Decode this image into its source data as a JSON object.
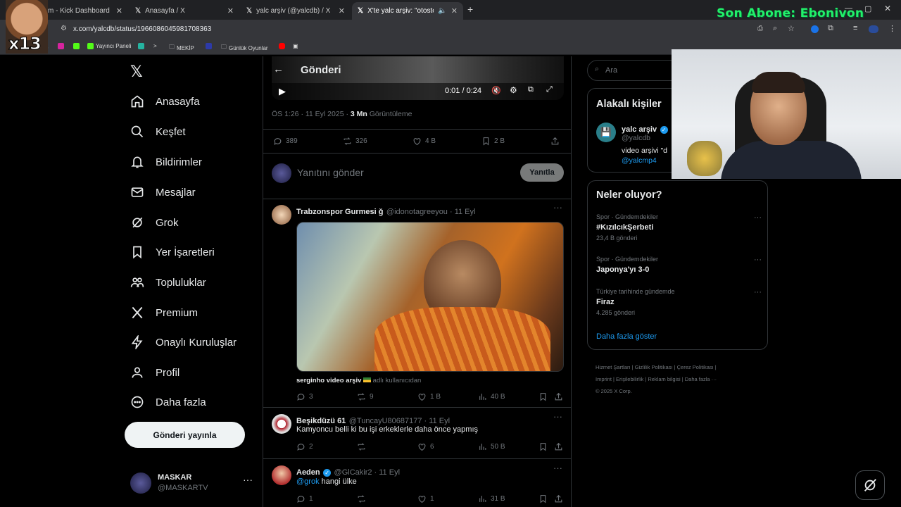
{
  "browser": {
    "tabs": [
      {
        "title": "m - Kick Dashboard",
        "active": false
      },
      {
        "title": "Anasayfa / X",
        "active": false
      },
      {
        "title": "yalc arşiv (@yalcdb) / X",
        "active": false
      },
      {
        "title": "X'te yalc arşiv: \"otostop çeki",
        "active": true
      }
    ],
    "url": "x.com/yalcdb/status/1966086045981708363",
    "bookmarks": [
      "Yayıncı Paneli",
      "MEKİP",
      "Günlük Oyunlar"
    ]
  },
  "overlay": {
    "text": "Son Abone: Ebonivon",
    "badge": "x13"
  },
  "sidebar": {
    "items": [
      {
        "label": "Anasayfa",
        "icon": "home-icon"
      },
      {
        "label": "Keşfet",
        "icon": "search-icon"
      },
      {
        "label": "Bildirimler",
        "icon": "bell-icon"
      },
      {
        "label": "Mesajlar",
        "icon": "mail-icon"
      },
      {
        "label": "Grok",
        "icon": "grok-icon"
      },
      {
        "label": "Yer İşaretleri",
        "icon": "bookmark-icon"
      },
      {
        "label": "Topluluklar",
        "icon": "communities-icon"
      },
      {
        "label": "Premium",
        "icon": "x-icon"
      },
      {
        "label": "Onaylı Kuruluşlar",
        "icon": "lightning-icon"
      },
      {
        "label": "Profil",
        "icon": "person-icon"
      },
      {
        "label": "Daha fazla",
        "icon": "more-circle-icon"
      }
    ],
    "post_button": "Gönderi yayınla",
    "profile": {
      "name": "MASKAR",
      "handle": "@MASKARTV"
    }
  },
  "main": {
    "header": {
      "title": "Gönderi"
    },
    "video": {
      "time": "0:01 / 0:24"
    },
    "meta": {
      "time": "ÖS 1:26 · 11 Eyl 2025 · ",
      "views": "3 Mn",
      "views_label": " Görüntüleme"
    },
    "stats": {
      "replies": "389",
      "reposts": "326",
      "likes": "4 B",
      "bookmarks": "2 B"
    },
    "reply": {
      "placeholder": "Yanıtını gönder",
      "button": "Yanıtla"
    },
    "replies": [
      {
        "name": "Trabzonspor Gurmesi ğ",
        "handle": "@idonotagreeyou · 11 Eyl",
        "caption_user": "serginho video arşiv",
        "caption_rest": " adlı kullanıcıdan",
        "replies": "3",
        "reposts": "9",
        "likes": "1 B",
        "views": "40 B"
      },
      {
        "name": "Beşikdüzü 61",
        "handle": "@TuncayU80687177 · 11 Eyl",
        "text": "Kamyoncu belli ki bu işi erkeklerle daha önce yapmış",
        "replies": "2",
        "reposts": "",
        "likes": "6",
        "views": "50 B"
      },
      {
        "name": "Aeden",
        "handle": "@GlCakir2 · 11 Eyl",
        "mention": "@grok",
        "text": " hangi ülke",
        "replies": "1",
        "reposts": "",
        "likes": "1",
        "views": "31 B"
      }
    ]
  },
  "right": {
    "search_placeholder": "Ara",
    "related": {
      "title": "Alakalı kişiler",
      "name": "yalc arşiv",
      "handle": "@yalcdb",
      "bio": "video arşivi \"d",
      "link": "@yalcmp4"
    },
    "trends": {
      "title": "Neler oluyor?",
      "items": [
        {
          "context": "Spor · Gündemdekiler",
          "name": "#KızılcıkŞerbeti",
          "count": "23,4 B gönderi"
        },
        {
          "context": "Spor · Gündemdekiler",
          "name": "Japonya'yı 3-0",
          "count": ""
        },
        {
          "context": "Türkiye tarihinde gündemde",
          "name": "Firaz",
          "count": "4.285 gönderi"
        }
      ],
      "more": "Daha fazla göster"
    },
    "footer": {
      "line1": [
        "Hizmet Şartları",
        "Gizlilik Politikası",
        "Çerez Politikası"
      ],
      "line2": [
        "Imprint",
        "Erişilebilirlik",
        "Reklam bilgisi",
        "Daha fazla ···"
      ],
      "copyright": "© 2025 X Corp."
    }
  },
  "colors": {
    "accent": "#1d9bf0",
    "overlay": "#22f06a",
    "border": "#2f3336"
  }
}
